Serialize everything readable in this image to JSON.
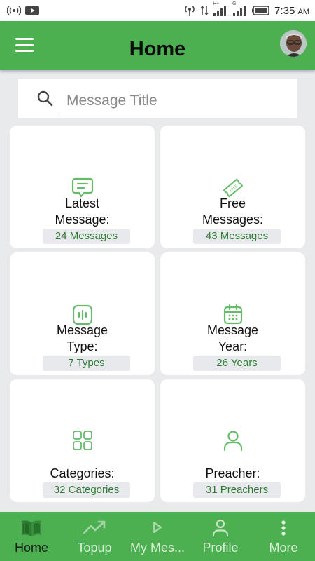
{
  "status_bar": {
    "time": "7:35",
    "ampm": "AM",
    "network_hplus": "H+",
    "network_g": "G"
  },
  "header": {
    "title": "Home"
  },
  "search": {
    "placeholder": "Message Title",
    "value": ""
  },
  "cards": [
    {
      "label_line1": "Latest",
      "label_line2": "Message:",
      "count": "24 Messages",
      "icon": "chat-icon"
    },
    {
      "label_line1": "Free",
      "label_line2": "Messages:",
      "count": "43 Messages",
      "icon": "ticket-icon"
    },
    {
      "label_line1": "Message",
      "label_line2": "Type:",
      "count": "7 Types",
      "icon": "audio-wave-icon"
    },
    {
      "label_line1": "Message",
      "label_line2": "Year:",
      "count": "26 Years",
      "icon": "calendar-icon"
    },
    {
      "label_line1": "Categories:",
      "count": "32 Categories",
      "icon": "grid-icon"
    },
    {
      "label_line1": "Preacher:",
      "count": "31 Preachers",
      "icon": "person-icon"
    }
  ],
  "bottom_nav": [
    {
      "label": "Home",
      "icon": "book-icon",
      "active": true
    },
    {
      "label": "Topup",
      "icon": "trending-up-icon",
      "active": false
    },
    {
      "label": "My Mes...",
      "icon": "play-icon",
      "active": false
    },
    {
      "label": "Profile",
      "icon": "person-icon",
      "active": false
    },
    {
      "label": "More",
      "icon": "more-vertical-icon",
      "active": false
    }
  ],
  "colors": {
    "primary": "#4caf50",
    "accent_text": "#2e7d32",
    "icon_green": "#66bb6a",
    "background": "#e9eaec"
  }
}
